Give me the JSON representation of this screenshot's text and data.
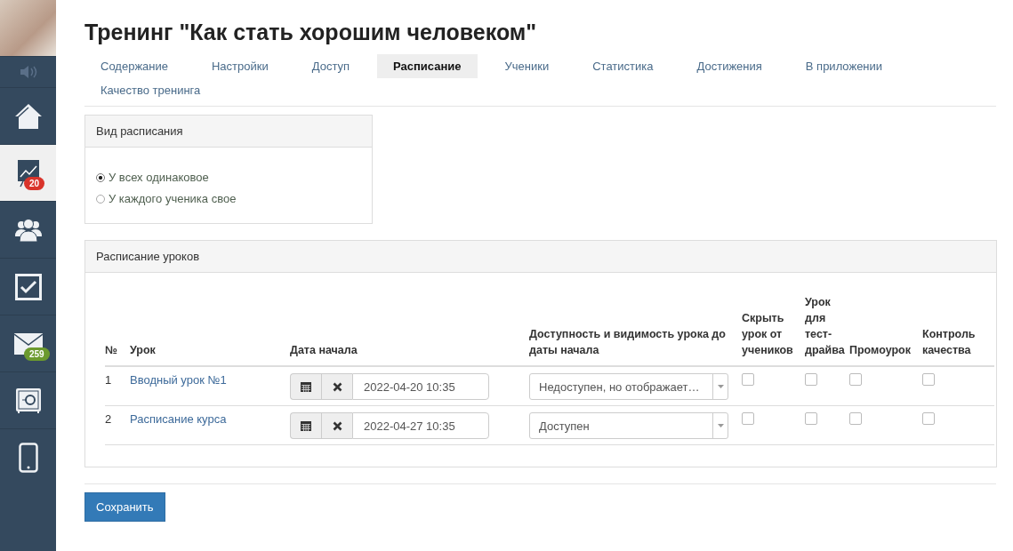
{
  "sidebar": {
    "items": [
      {
        "kind": "home",
        "selected": false
      },
      {
        "kind": "chart",
        "selected": true,
        "badge": "20",
        "color": "#d9342b"
      },
      {
        "kind": "users",
        "selected": false
      },
      {
        "kind": "check",
        "selected": false
      },
      {
        "kind": "mail",
        "selected": false,
        "badge": "259",
        "color": "#6c9a2e"
      },
      {
        "kind": "safe",
        "selected": false
      },
      {
        "kind": "phone",
        "selected": false
      }
    ]
  },
  "title": "Тренинг \"Как стать хорошим человеком\"",
  "tabs": [
    {
      "label": "Содержание",
      "selected": false
    },
    {
      "label": "Настройки",
      "selected": false
    },
    {
      "label": "Доступ",
      "selected": false
    },
    {
      "label": "Расписание",
      "selected": true
    },
    {
      "label": "Ученики",
      "selected": false
    },
    {
      "label": "Статистика",
      "selected": false
    },
    {
      "label": "Достижения",
      "selected": false
    },
    {
      "label": "В приложении",
      "selected": false
    },
    {
      "label": "Качество тренинга",
      "selected": false
    }
  ],
  "schedule_type": {
    "heading": "Вид расписания",
    "options": [
      {
        "label": "У всех одинаковое",
        "selected": true
      },
      {
        "label": "У каждого ученика свое",
        "selected": false
      }
    ]
  },
  "lessons": {
    "heading": "Расписание уроков",
    "columns": [
      "№",
      "Урок",
      "Дата начала",
      "Доступность и видимость урока до даты начала",
      "Скрыть урок от учеников",
      "Урок для тест-драйва",
      "Промоурок",
      "Контроль качества"
    ],
    "rows": [
      {
        "number": "1",
        "lesson": "Вводный урок №1",
        "date": "2022-04-20 10:35",
        "availability": "Недоступен, но отображает…",
        "hide": false,
        "test_drive": false,
        "promo": false,
        "quality": false
      },
      {
        "number": "2",
        "lesson": "Расписание курса",
        "date": "2022-04-27 10:35",
        "availability": "Доступен",
        "hide": false,
        "test_drive": false,
        "promo": false,
        "quality": false
      }
    ]
  },
  "save_button": "Сохранить"
}
